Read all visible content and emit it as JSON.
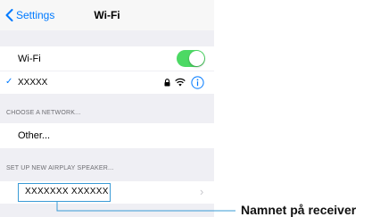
{
  "navbar": {
    "back_label": "Settings",
    "title": "Wi-Fi"
  },
  "wifi_row": {
    "label": "Wi-Fi",
    "toggle_on": true
  },
  "connected_network": {
    "name": "XXXXX"
  },
  "sections": {
    "choose_network": {
      "header": "CHOOSE A NETWORK...",
      "other_label": "Other..."
    },
    "airplay": {
      "header": "SET UP NEW AIRPLAY SPEAKER...",
      "speaker_name": "XXXXXXX  XXXXXX"
    }
  },
  "annotation": {
    "text": "Namnet på receiver"
  },
  "colors": {
    "accent": "#007aff",
    "toggle": "#4cd964",
    "callout_line": "#3a9bd6"
  }
}
